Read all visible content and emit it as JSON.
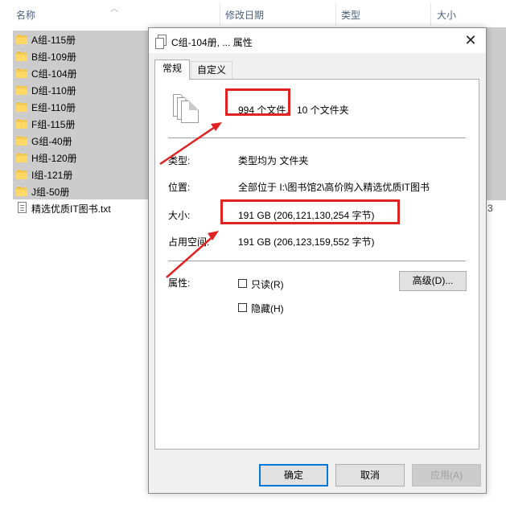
{
  "explorer": {
    "columns": {
      "name": "名称",
      "modified": "修改日期",
      "type": "类型",
      "size": "大小"
    },
    "items": [
      {
        "label": "A组-115册",
        "kind": "folder",
        "selected": true
      },
      {
        "label": "B组-109册",
        "kind": "folder",
        "selected": true
      },
      {
        "label": "C组-104册",
        "kind": "folder",
        "selected": true
      },
      {
        "label": "D组-110册",
        "kind": "folder",
        "selected": true
      },
      {
        "label": "E组-110册",
        "kind": "folder",
        "selected": true
      },
      {
        "label": "F组-115册",
        "kind": "folder",
        "selected": true
      },
      {
        "label": "G组-40册",
        "kind": "folder",
        "selected": true
      },
      {
        "label": "H组-120册",
        "kind": "folder",
        "selected": true
      },
      {
        "label": "I组-121册",
        "kind": "folder",
        "selected": true
      },
      {
        "label": "J组-50册",
        "kind": "folder",
        "selected": true
      },
      {
        "label": "精选优质IT图书.txt",
        "kind": "text-file",
        "selected": false
      }
    ],
    "peek_value": "3"
  },
  "dialog": {
    "title": "C组-104册, ... 属性",
    "close_glyph": "✕",
    "tabs": [
      {
        "label": "常规",
        "active": true
      },
      {
        "label": "自定义",
        "active": false
      }
    ],
    "summary": {
      "files": "994 个文件,",
      "folders": "10 个文件夹"
    },
    "fields": {
      "type_label": "类型:",
      "type_value": "类型均为 文件夹",
      "location_label": "位置:",
      "location_value": "全部位于 I:\\图书馆2\\高价购入精选优质IT图书",
      "size_label": "大小:",
      "size_value": "191 GB (206,121,130,254 字节)",
      "ondisk_label": "占用空间:",
      "ondisk_value": "191 GB (206,123,159,552 字节)",
      "attributes_label": "属性:",
      "readonly_label": "只读(R)",
      "hidden_label": "隐藏(H)",
      "advanced_label": "高级(D)..."
    },
    "buttons": {
      "ok": "确定",
      "cancel": "取消",
      "apply": "应用(A)"
    }
  },
  "colors": {
    "annotation_red": "#e02222",
    "selection_gray": "#cccccc",
    "default_button_border": "#0078d7",
    "folder_yellow": "#ffd866"
  }
}
